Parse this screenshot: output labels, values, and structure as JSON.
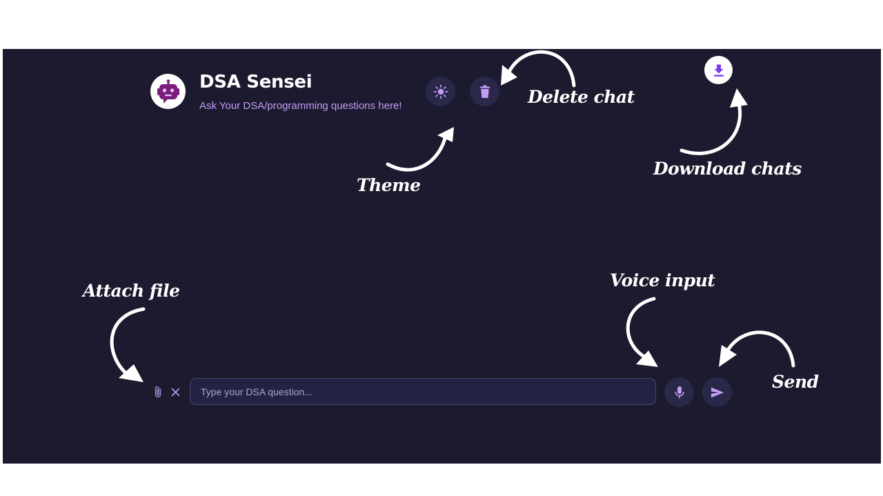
{
  "header": {
    "title": "DSA Sensei",
    "subtitle": "Ask Your DSA/programming questions here!",
    "avatar_icon": "robot-icon"
  },
  "toolbar": {
    "theme_icon": "sun-icon",
    "delete_icon": "trash-icon",
    "download_icon": "download-icon"
  },
  "annotations": {
    "theme": "Theme",
    "delete_chat": "Delete chat",
    "download_chats": "Download chats",
    "attach_file": "Attach file",
    "voice_input": "Voice input",
    "send": "Send"
  },
  "composer": {
    "placeholder": "Type your DSA question...",
    "value": "",
    "attach_icon": "paperclip-icon",
    "clear_icon": "close-icon",
    "mic_icon": "microphone-icon",
    "send_icon": "send-icon"
  },
  "colors": {
    "background": "#1b1a2e",
    "accent": "#c39cf6",
    "button_bg": "#292848",
    "download_purple": "#7c3aed",
    "avatar_purple": "#7a1e7e"
  }
}
